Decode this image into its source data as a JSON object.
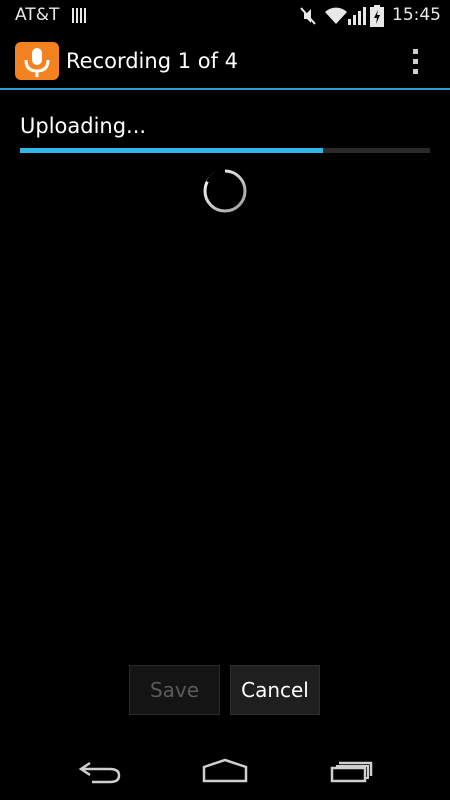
{
  "status_bar": {
    "carrier": "AT&T",
    "time": "15:45",
    "icons": [
      "carrier-signal-icon",
      "mute-icon",
      "wifi-icon",
      "cell-signal-icon",
      "battery-charging-icon"
    ]
  },
  "action_bar": {
    "app_icon": "microphone-icon",
    "title": "Recording 1 of 4",
    "overflow_icon": "overflow-menu-icon"
  },
  "upload": {
    "label": "Uploading...",
    "progress": 0.74
  },
  "buttons": {
    "save": "Save",
    "cancel": "Cancel"
  },
  "colors": {
    "accent": "#33b5e5",
    "app_icon_bg": "#f58220"
  },
  "nav_bar": {
    "icons": [
      "back-icon",
      "home-icon",
      "recents-icon"
    ]
  }
}
